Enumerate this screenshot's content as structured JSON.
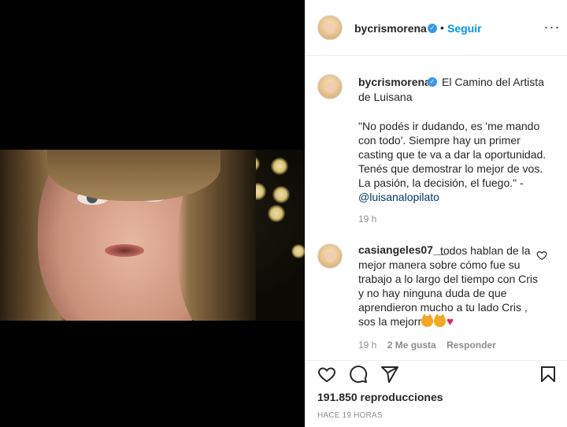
{
  "post": {
    "username": "bycrismorena",
    "verified_mark": "✓",
    "dot": "•",
    "follow_label": "Seguir",
    "more_label": "···",
    "caption": {
      "first_line": "El Camino del Artista",
      "second_line": "de Luisana",
      "quote": "\"No podés ir dudando, es 'me mando con todo'. Siempre hay un primer casting que te va a dar la oportunidad. Tenés que demostrar lo mejor de vos. La pasión, la decisión, el fuego.\" -",
      "mention": "@luisanalopilato",
      "time": "19 h"
    },
    "comment": {
      "username": "casiangeles07__",
      "text": "todos hablan de la mejor manera sobre cómo fue su trabajo a lo largo del tiempo con Cris y no hay ninguna duda de que aprendieron mucho a tu lado Cris , sos la mejorr",
      "emoji": [
        "cat-face",
        "cat-face",
        "red-heart"
      ],
      "time": "19 h",
      "likes": "2 Me gusta",
      "reply": "Responder"
    },
    "views": "191.850 reproducciones",
    "posted_ago": "HACE 19 HORAS"
  },
  "colors": {
    "link_blue": "#0095f6",
    "mention_blue": "#00376b",
    "muted_gray": "#8e8e8e",
    "text": "#262626",
    "verified_blue": "#3897f0",
    "divider": "#efefef"
  },
  "icons": {
    "like": "heart-icon",
    "comment": "comment-icon",
    "share": "send-icon",
    "save": "bookmark-icon",
    "comment_like": "small-heart-icon",
    "more": "more-options-icon"
  }
}
